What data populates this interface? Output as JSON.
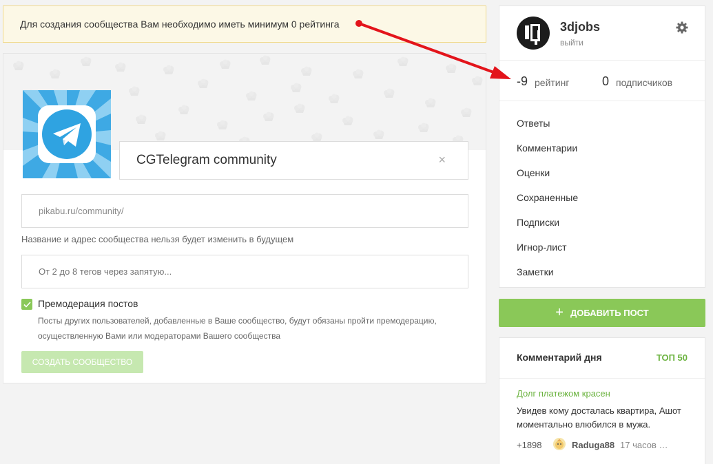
{
  "notice": {
    "text": "Для создания сообщества Вам необходимо иметь минимум 0 рейтинга"
  },
  "community_form": {
    "name_value": "CGTelegram community",
    "clear_symbol": "×",
    "url_value": "pikabu.ru/community/",
    "name_hint": "Название и адрес сообщества нельзя будет изменить в будущем",
    "tags_placeholder": "От 2 до 8 тегов через запятую...",
    "premoderation": {
      "checked": true,
      "label": "Премодерация постов",
      "description": "Посты других пользователей, добавленные в Ваше сообщество, будут обязаны пройти премодерацию, осуществленную Вами или модераторами Вашего сообщества"
    },
    "submit_label": "СОЗДАТЬ СООБЩЕСТВО",
    "avatar_icon": "telegram-icon"
  },
  "profile": {
    "username": "3djobs",
    "logout_label": "выйти",
    "rating_value": "-9",
    "rating_label": "рейтинг",
    "subscribers_value": "0",
    "subscribers_label": "подписчиков",
    "menu": [
      {
        "label": "Ответы"
      },
      {
        "label": "Комментарии"
      },
      {
        "label": "Оценки"
      },
      {
        "label": "Сохраненные"
      },
      {
        "label": "Подписки"
      },
      {
        "label": "Игнор-лист"
      },
      {
        "label": "Заметки"
      }
    ]
  },
  "add_post": {
    "plus": "+",
    "label": "ДОБАВИТЬ ПОСТ"
  },
  "comment_of_day": {
    "title": "Комментарий дня",
    "top_label": "ТОП 50",
    "story_title": "Долг платежом красен",
    "text": "Увидев кому досталась квартира, Ашот моментально влюбился в мужа.",
    "rating": "+1898",
    "author": "Raduga88",
    "time": "17 часов …"
  },
  "colors": {
    "accent_green": "#8ac858",
    "link_green": "#6bb33f",
    "notice_bg": "#fcf8e6",
    "arrow_red": "#e3141b",
    "telegram_blue": "#2fa3e1"
  }
}
